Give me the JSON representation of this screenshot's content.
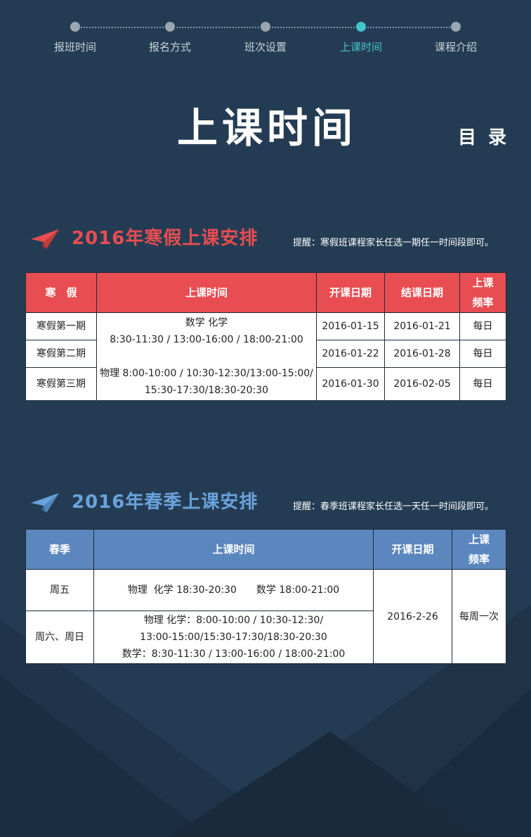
{
  "nav": {
    "steps": [
      {
        "label": "报班时间",
        "active": false
      },
      {
        "label": "报名方式",
        "active": false
      },
      {
        "label": "班次设置",
        "active": false
      },
      {
        "label": "上课时间",
        "active": true
      },
      {
        "label": "课程介绍",
        "active": false
      }
    ]
  },
  "header": {
    "title": "上课时间",
    "toc": "目 录"
  },
  "winter": {
    "title": "2016年寒假上课安排",
    "note": "提醒：寒假班课程家长任选一期任一时间段即可。",
    "color": "#e84d51",
    "columns": [
      "寒　假",
      "上课时间",
      "开课日期",
      "结课日期",
      "上课",
      "频率"
    ],
    "time_math_subject": "数学 化学",
    "time_math_slots": "8:30-11:30 / 13:00-16:00 / 18:00-21:00",
    "time_phys_line1": "物理 8:00-10:00 / 10:30-12:30/13:00-15:00/",
    "time_phys_line2": "15:30-17:30/18:30-20:30",
    "rows": [
      {
        "label": "寒假第一期",
        "start": "2016-01-15",
        "end": "2016-01-21",
        "freq": "每日"
      },
      {
        "label": "寒假第二期",
        "start": "2016-01-22",
        "end": "2016-01-28",
        "freq": "每日"
      },
      {
        "label": "寒假第三期",
        "start": "2016-01-30",
        "end": "2016-02-05",
        "freq": "每日"
      }
    ]
  },
  "spring": {
    "title": "2016年春季上课安排",
    "note": "提醒：春季班课程家长任选一天任一时间段即可。",
    "color": "#5b87be",
    "columns": [
      "春季",
      "上课时间",
      "开课日期",
      "上课",
      "频率"
    ],
    "rows": [
      {
        "label": "周五",
        "time_line1": "物理  化学 18:30-20:30　　数学 18:00-21:00"
      },
      {
        "label": "周六、周日",
        "time_line1": "物理  化学：8:00-10:00 / 10:30-12:30/",
        "time_line2": "13:00-15:00/15:30-17:30/18:30-20:30",
        "time_line3": "数学：8:30-11:30 / 13:00-16:00 / 18:00-21:00"
      }
    ],
    "start": "2016-2-26",
    "freq": "每周一次"
  }
}
